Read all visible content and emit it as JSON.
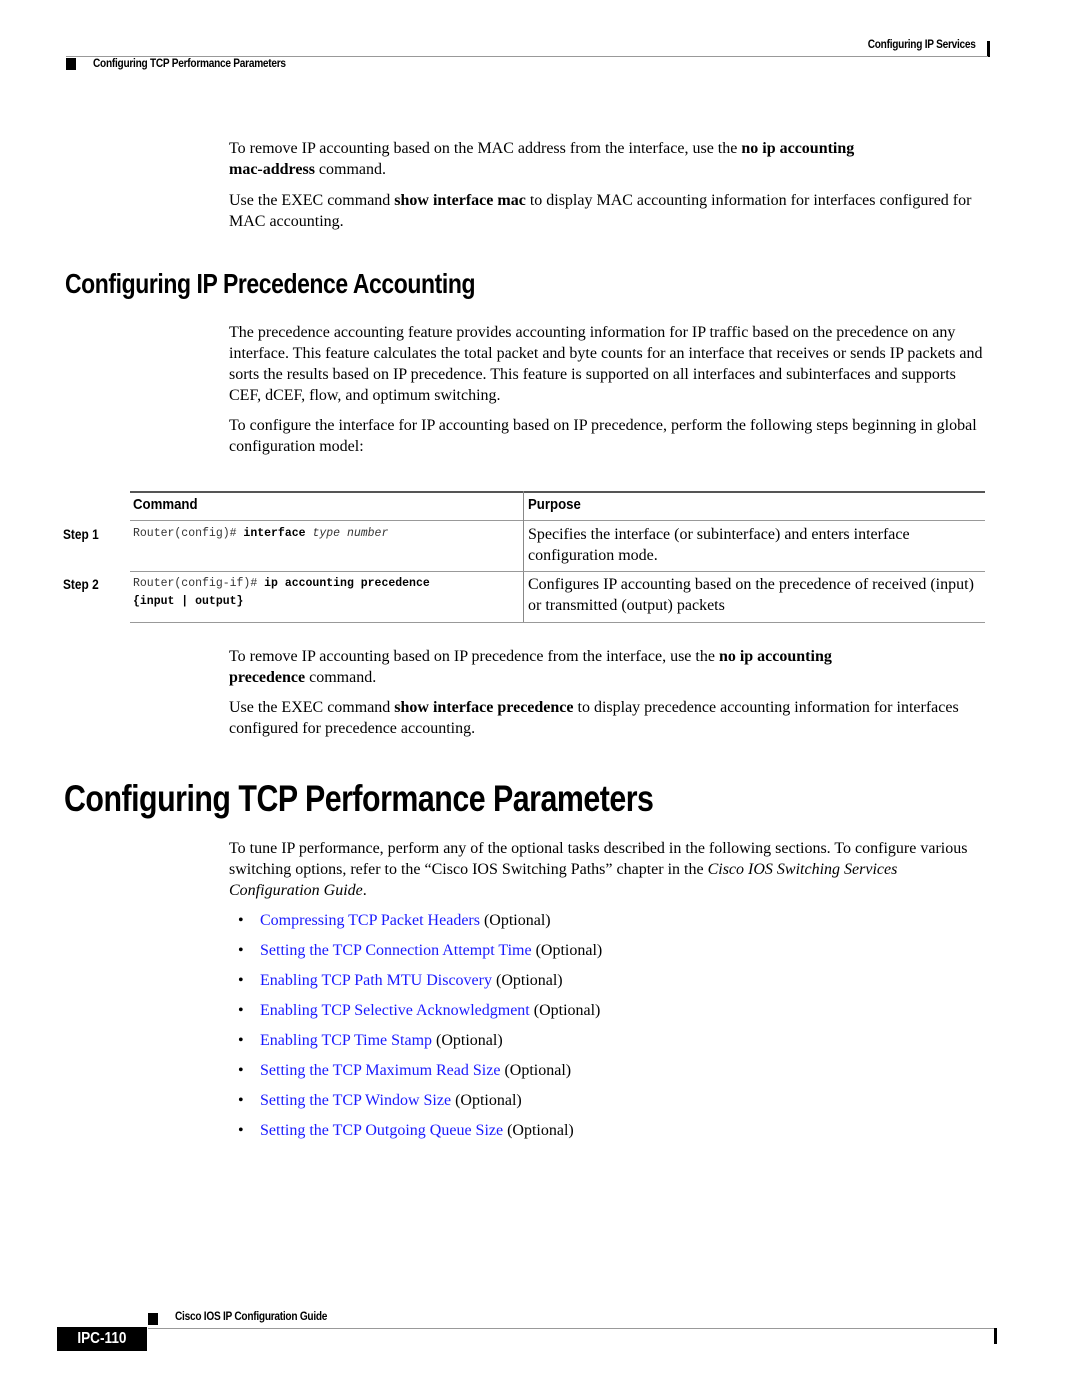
{
  "header": {
    "chapter": "Configuring IP Services",
    "section": "Configuring TCP Performance Parameters"
  },
  "intro": {
    "p1": {
      "pre": "To remove IP accounting based on the MAC address from the interface, use the ",
      "bold1": "no ip accounting",
      "bold2": "mac-address",
      "post": " command."
    },
    "p2": {
      "pre": "Use the EXEC command ",
      "bold": "show interface mac",
      "post": " to display MAC accounting information for interfaces configured for MAC accounting."
    }
  },
  "precedence_section": {
    "title": "Configuring IP Precedence Accounting",
    "p1": "The precedence accounting feature provides accounting information for IP traffic based on the precedence on any interface. This feature calculates the total packet and byte counts for an interface that receives or sends IP packets and sorts the results based on IP precedence. This feature is supported on all interfaces and subinterfaces and supports CEF, dCEF, flow, and optimum switching.",
    "p2": "To configure the interface for IP accounting based on IP precedence, perform the following steps beginning in global configuration model:",
    "table": {
      "headers": {
        "command": "Command",
        "purpose": "Purpose"
      },
      "rows": [
        {
          "step": "Step 1",
          "cmd_prompt": "Router(config)# ",
          "cmd_bold": "interface",
          "cmd_italic": " type number",
          "purpose": "Specifies the interface (or subinterface) and enters interface configuration mode."
        },
        {
          "step": "Step 2",
          "cmd_prompt": "Router(config-if)# ",
          "cmd_bold": "ip accounting precedence",
          "cmd_line2": "{input | output}",
          "purpose": "Configures IP accounting based on the precedence of received (input) or transmitted (output) packets"
        }
      ]
    },
    "p3": {
      "pre": "To remove IP accounting based on IP precedence from the interface, use the ",
      "bold1": "no ip accounting",
      "bold2": "precedence",
      "post": " command."
    },
    "p4": {
      "pre": "Use the EXEC command ",
      "bold": "show interface precedence",
      "post": " to display precedence accounting information for interfaces configured for precedence accounting."
    }
  },
  "tcp_section": {
    "title": "Configuring TCP Performance Parameters",
    "intro": {
      "pre": "To tune IP performance, perform any of the optional tasks described in the following sections. To configure various switching options, refer to the “Cisco IOS Switching Paths” chapter in the ",
      "italic": "Cisco IOS Switching Services Configuration Guide",
      "post": "."
    },
    "tasks": [
      {
        "link": "Compressing TCP Packet Headers",
        "note": " (Optional)"
      },
      {
        "link": "Setting the TCP Connection Attempt Time",
        "note": " (Optional)"
      },
      {
        "link": "Enabling TCP Path MTU Discovery",
        "note": " (Optional)"
      },
      {
        "link": "Enabling TCP Selective Acknowledgment",
        "note": " (Optional)"
      },
      {
        "link": "Enabling TCP Time Stamp",
        "note": " (Optional)"
      },
      {
        "link": "Setting the TCP Maximum Read Size",
        "note": " (Optional)"
      },
      {
        "link": "Setting the TCP Window Size",
        "note": " (Optional)"
      },
      {
        "link": "Setting the TCP Outgoing Queue Size",
        "note": " (Optional)"
      }
    ],
    "bullet_glyph": "•",
    "link_color": "#1a1aff"
  },
  "footer": {
    "guide_title": "Cisco IOS IP Configuration Guide",
    "page_number": "IPC-110"
  }
}
